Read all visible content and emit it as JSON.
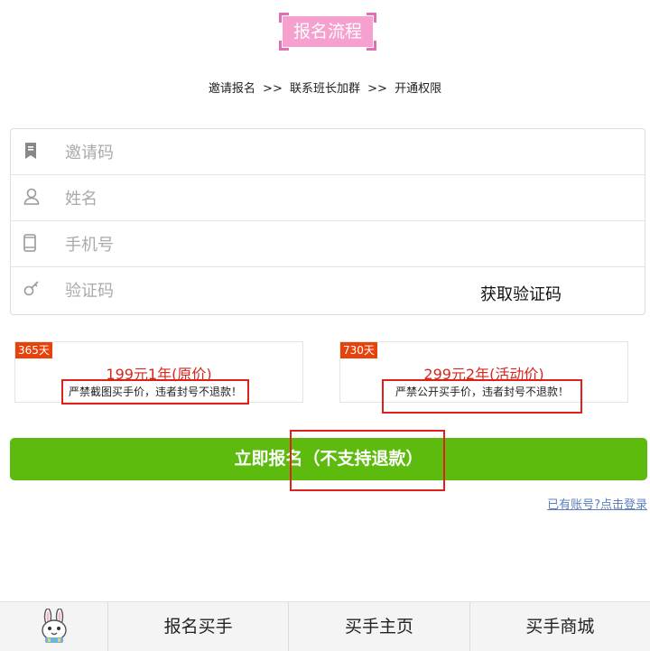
{
  "header": {
    "title": "报名流程"
  },
  "flow": {
    "steps": [
      "邀请报名",
      "联系班长加群",
      "开通权限"
    ],
    "separator": ">>"
  },
  "form": {
    "invite_code": {
      "placeholder": "邀请码",
      "icon": "bookmark-icon"
    },
    "name": {
      "placeholder": "姓名",
      "icon": "user-icon"
    },
    "phone": {
      "placeholder": "手机号",
      "icon": "phone-icon"
    },
    "verify_code": {
      "placeholder": "验证码",
      "icon": "key-icon",
      "get_code_label": "获取验证码"
    }
  },
  "plans": [
    {
      "tag": "365天",
      "price": "199元1年(原价)",
      "warning": "严禁截图买手价，违者封号不退款！"
    },
    {
      "tag": "730天",
      "price": "299元2年(活动价)",
      "warning": "严禁公开买手价，违者封号不退款！"
    }
  ],
  "submit": {
    "label": "立即报名（不支持退款）"
  },
  "login_link": "已有账号?点击登录",
  "bottom_nav": {
    "logo_icon": "bunny-mascot-icon",
    "items": [
      "报名买手",
      "买手主页",
      "买手商城"
    ]
  },
  "colors": {
    "title_badge": "#f5a0cf",
    "accent_green": "#5cbb0c",
    "price_red": "#d8261b",
    "tag_red": "#e8420c",
    "link_blue": "#5b7fbf"
  }
}
